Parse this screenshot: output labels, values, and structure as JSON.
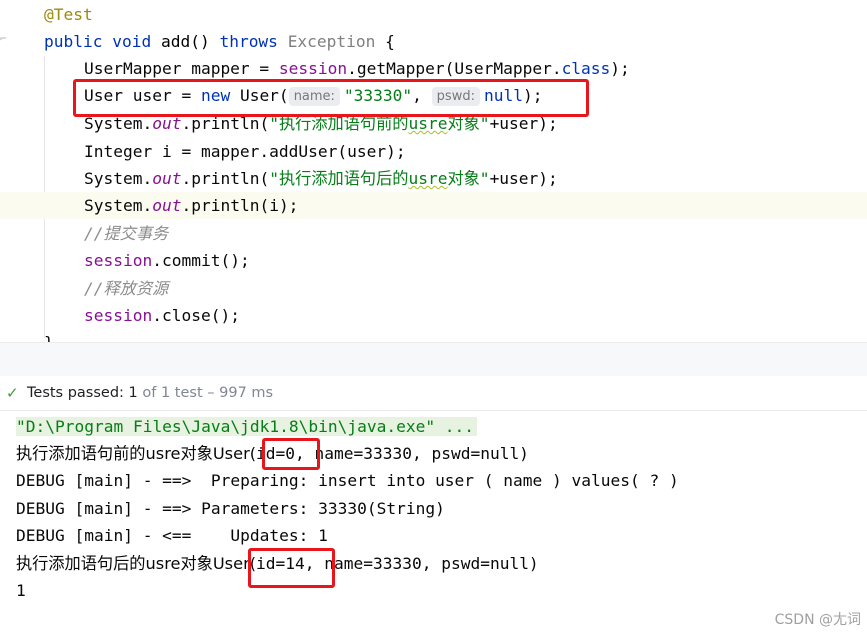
{
  "editor": {
    "lines": {
      "annotation": "@Test",
      "sig_public": "public",
      "sig_void": "void",
      "sig_add": "add() ",
      "sig_throws": "throws",
      "sig_exception": "Exception",
      "sig_brace": " {",
      "l3_a": "UserMapper mapper = ",
      "l3_session": "session",
      "l3_b": ".getMapper(UserMapper.",
      "l3_class": "class",
      "l3_c": ");",
      "l4_a": "User user = ",
      "l4_new": "new",
      "l4_b": " User(",
      "l4_hint_name": "name:",
      "l4_str": "\"33330\"",
      "l4_comma": ",",
      "l4_hint_pswd": "pswd:",
      "l4_null": "null",
      "l4_end": ");",
      "l5_a": "System.",
      "l5_out": "out",
      "l5_b": ".println(",
      "l5_str_a": "\"执行添加语句前的",
      "l5_str_usre": "usre",
      "l5_str_b": "对象\"",
      "l5_c": "+user);",
      "l6": "Integer i = mapper.addUser(user);",
      "l7_a": "System.",
      "l7_out": "out",
      "l7_b": ".println(",
      "l7_str_a": "\"执行添加语句后的",
      "l7_str_usre": "usre",
      "l7_str_b": "对象\"",
      "l7_c": "+user);",
      "l8_a": "System.",
      "l8_out": "out",
      "l8_b": ".println(i);",
      "l9_comment": "//提交事务",
      "l10_session": "session",
      "l10_b": ".commit();",
      "l11_comment": "//释放资源",
      "l12_session": "session",
      "l12_b": ".close();",
      "l13": "}"
    }
  },
  "test_status": {
    "icon": "check-icon",
    "label": "Tests passed: ",
    "count": "1",
    "detail": " of 1 test – 997 ms"
  },
  "console": {
    "cmd": "\"D:\\Program Files\\Java\\jdk1.8\\bin\\java.exe\" ...",
    "out1_prefix": "执行添加语句前的usre对象User(",
    "out1_id": "id=0,",
    "out1_rest": " name=33330, pswd=null)",
    "debug1": "DEBUG [main] - ==>  Preparing: insert into user ( name ) values( ? )",
    "debug2": "DEBUG [main] - ==> Parameters: 33330(String)",
    "debug3": "DEBUG [main] - <==    Updates: 1",
    "out2_prefix": "执行添加语句后的usre对象User(",
    "out2_id": "id=14,",
    "out2_rest": " name=33330, pswd=null)",
    "result": "1"
  },
  "watermark": "CSDN @尢词",
  "colors": {
    "keyword": "#0033b3",
    "string": "#067d17",
    "field": "#871094",
    "annotation": "#9e880d",
    "highlight_box": "#e8151b",
    "passed": "#3f9a3a"
  }
}
